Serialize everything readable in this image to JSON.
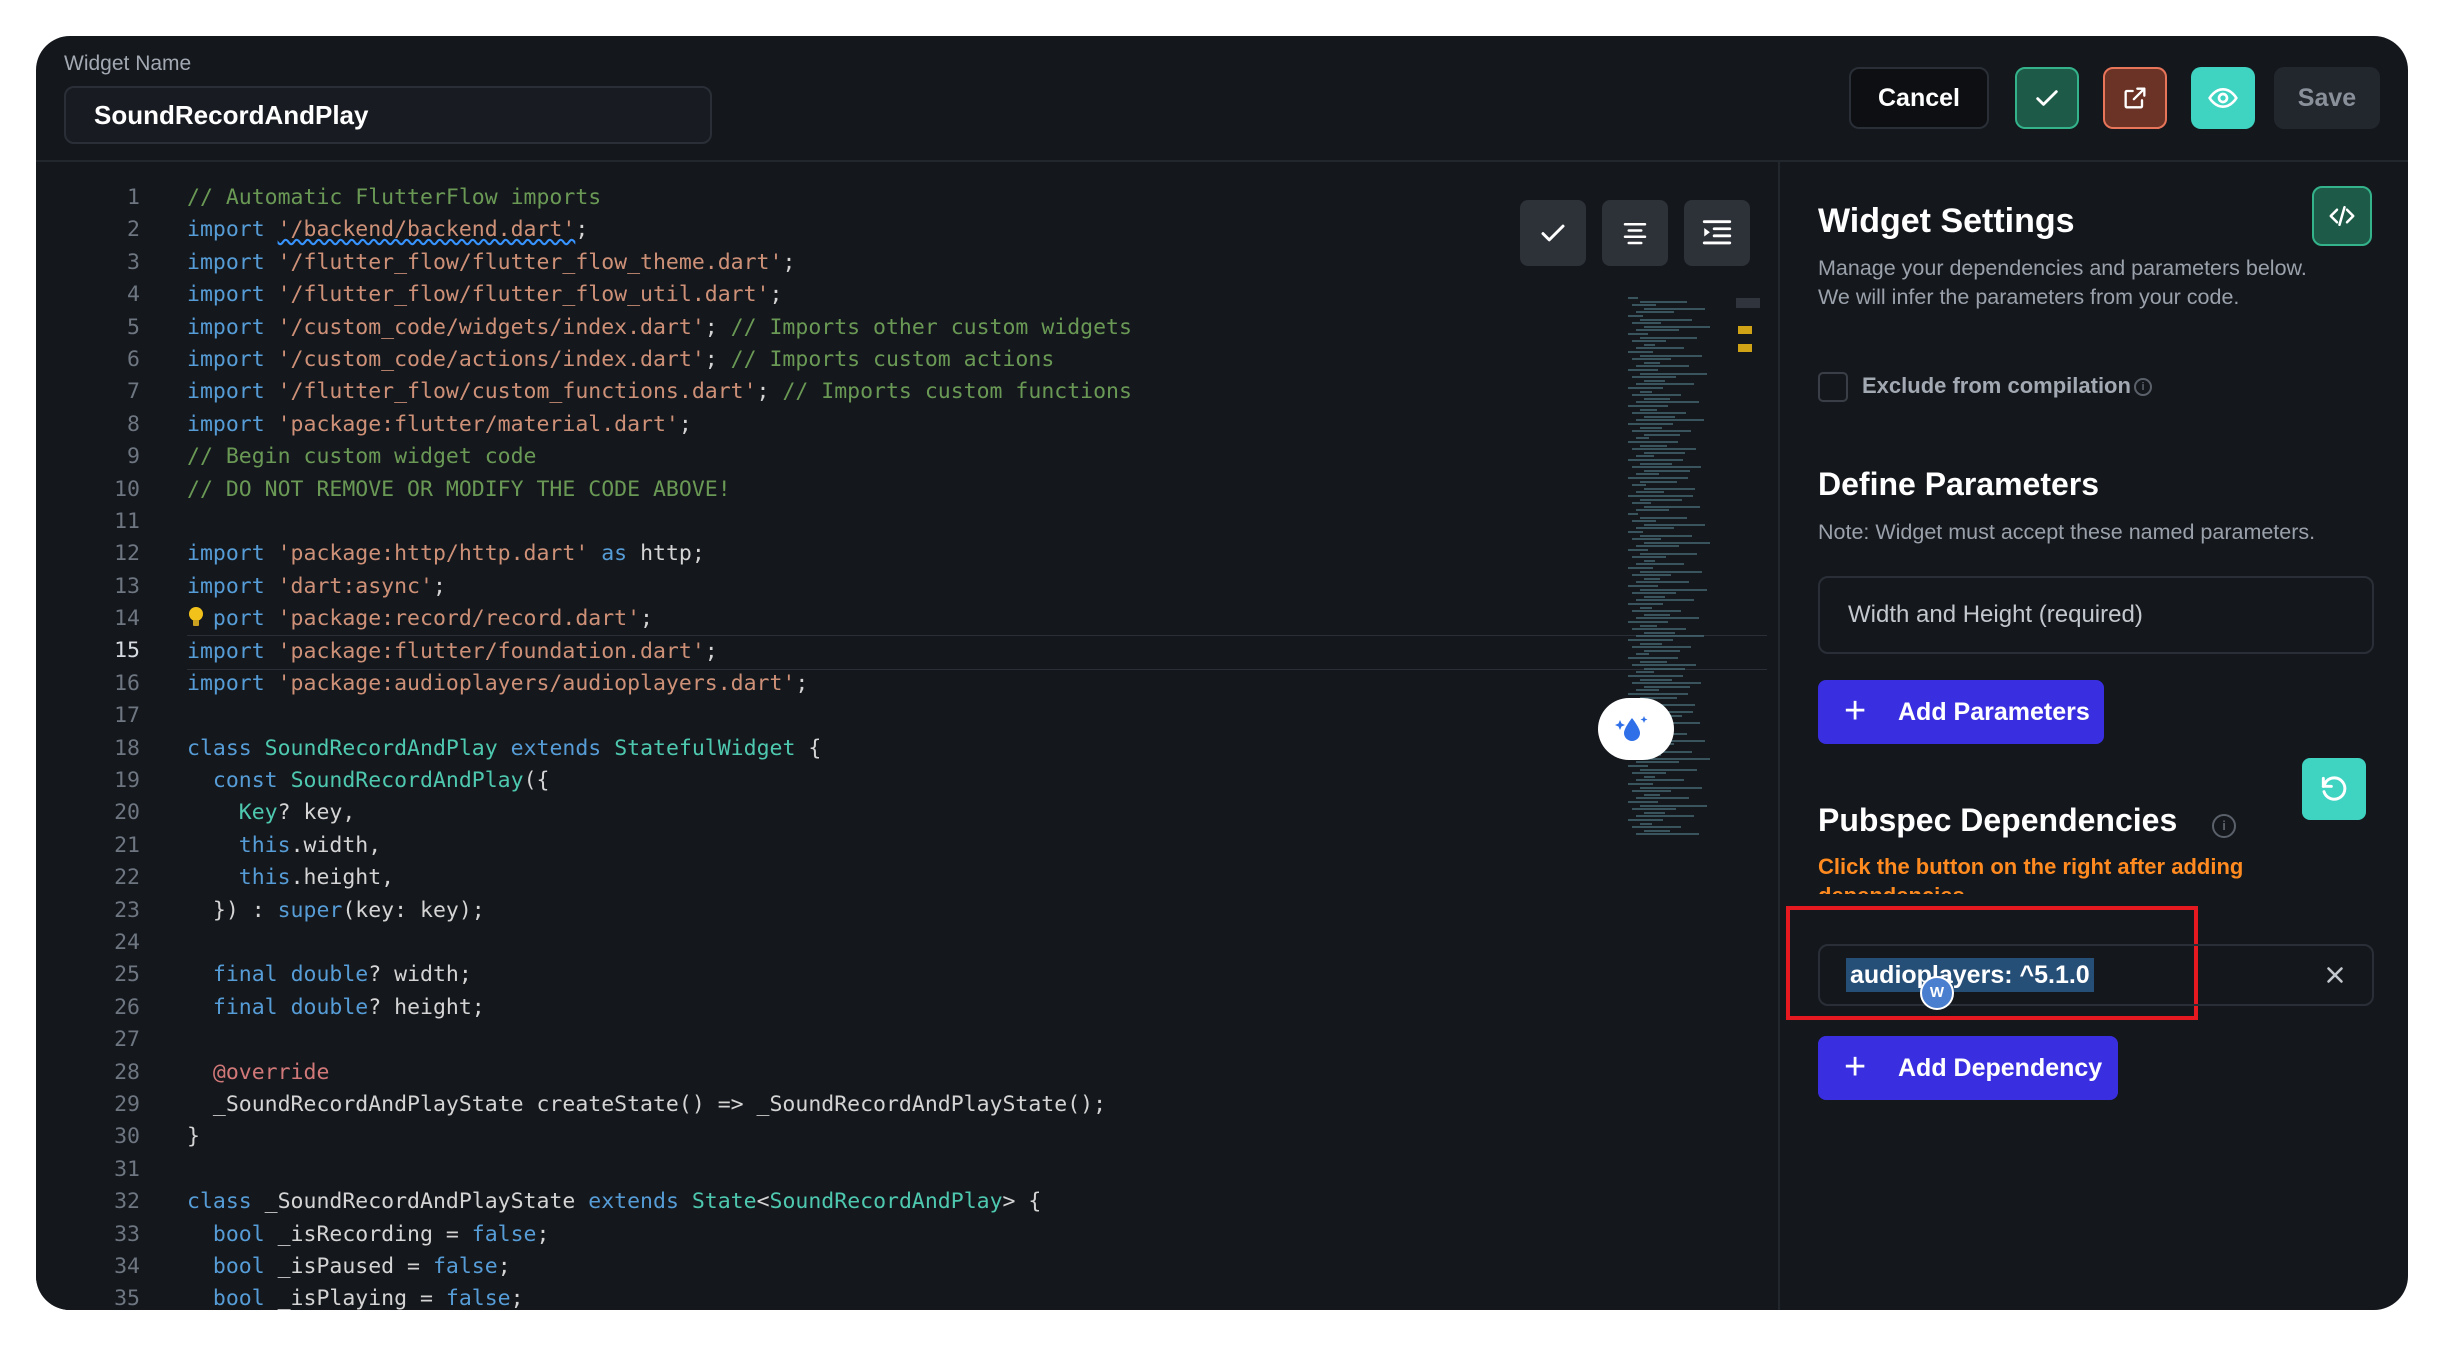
{
  "header": {
    "widget_name_label": "Widget Name",
    "widget_name_value": "SoundRecordAndPlay",
    "cancel_label": "Cancel",
    "save_label": "Save"
  },
  "editor": {
    "active_line": 15,
    "lines": [
      {
        "n": "1",
        "tokens": [
          [
            "// Automatic FlutterFlow imports",
            "cm"
          ]
        ]
      },
      {
        "n": "2",
        "tokens": [
          [
            "import ",
            "kw"
          ],
          [
            "'/backend/backend.dart'",
            "str-ul"
          ],
          [
            ";",
            "id"
          ]
        ]
      },
      {
        "n": "3",
        "tokens": [
          [
            "import ",
            "kw"
          ],
          [
            "'/flutter_flow/flutter_flow_theme.dart'",
            "str"
          ],
          [
            ";",
            "id"
          ]
        ]
      },
      {
        "n": "4",
        "tokens": [
          [
            "import ",
            "kw"
          ],
          [
            "'/flutter_flow/flutter_flow_util.dart'",
            "str"
          ],
          [
            ";",
            "id"
          ]
        ]
      },
      {
        "n": "5",
        "tokens": [
          [
            "import ",
            "kw"
          ],
          [
            "'/custom_code/widgets/index.dart'",
            "str"
          ],
          [
            "; ",
            "id"
          ],
          [
            "// Imports other custom widgets",
            "cm"
          ]
        ]
      },
      {
        "n": "6",
        "tokens": [
          [
            "import ",
            "kw"
          ],
          [
            "'/custom_code/actions/index.dart'",
            "str"
          ],
          [
            "; ",
            "id"
          ],
          [
            "// Imports custom actions",
            "cm"
          ]
        ]
      },
      {
        "n": "7",
        "tokens": [
          [
            "import ",
            "kw"
          ],
          [
            "'/flutter_flow/custom_functions.dart'",
            "str"
          ],
          [
            "; ",
            "id"
          ],
          [
            "// Imports custom functions",
            "cm"
          ]
        ]
      },
      {
        "n": "8",
        "tokens": [
          [
            "import ",
            "kw"
          ],
          [
            "'package:flutter/material.dart'",
            "str"
          ],
          [
            ";",
            "id"
          ]
        ]
      },
      {
        "n": "9",
        "tokens": [
          [
            "// Begin custom widget code",
            "cm"
          ]
        ]
      },
      {
        "n": "10",
        "tokens": [
          [
            "// DO NOT REMOVE OR MODIFY THE CODE ABOVE!",
            "cm"
          ]
        ]
      },
      {
        "n": "11",
        "tokens": []
      },
      {
        "n": "12",
        "tokens": [
          [
            "import ",
            "kw"
          ],
          [
            "'package:http/http.dart'",
            "str"
          ],
          [
            " as ",
            "kw"
          ],
          [
            "http;",
            "id"
          ]
        ]
      },
      {
        "n": "13",
        "tokens": [
          [
            "import ",
            "kw"
          ],
          [
            "'dart:async'",
            "str"
          ],
          [
            ";",
            "id"
          ]
        ]
      },
      {
        "n": "14",
        "tokens": [
          [
            "  port ",
            "kw"
          ],
          [
            "'package:record/record.dart'",
            "str"
          ],
          [
            ";",
            "id"
          ]
        ]
      },
      {
        "n": "15",
        "tokens": [
          [
            "import ",
            "kw"
          ],
          [
            "'package:flutter/foundation.dart'",
            "str"
          ],
          [
            ";",
            "id"
          ]
        ]
      },
      {
        "n": "16",
        "tokens": [
          [
            "import ",
            "kw"
          ],
          [
            "'package:audioplayers/audioplayers.dart'",
            "str"
          ],
          [
            ";",
            "id"
          ]
        ]
      },
      {
        "n": "17",
        "tokens": []
      },
      {
        "n": "18",
        "tokens": [
          [
            "class ",
            "kw"
          ],
          [
            "SoundRecordAndPlay ",
            "cls"
          ],
          [
            "extends ",
            "kw"
          ],
          [
            "StatefulWidget ",
            "cls"
          ],
          [
            "{",
            "id"
          ]
        ]
      },
      {
        "n": "19",
        "tokens": [
          [
            "  const ",
            "kw"
          ],
          [
            "SoundRecordAndPlay",
            "cls"
          ],
          [
            "({",
            "id"
          ]
        ]
      },
      {
        "n": "20",
        "tokens": [
          [
            "    Key",
            "cls"
          ],
          [
            "? key,",
            "id"
          ]
        ]
      },
      {
        "n": "21",
        "tokens": [
          [
            "    this",
            "kw"
          ],
          [
            ".width,",
            "id"
          ]
        ]
      },
      {
        "n": "22",
        "tokens": [
          [
            "    this",
            "kw"
          ],
          [
            ".height,",
            "id"
          ]
        ]
      },
      {
        "n": "23",
        "tokens": [
          [
            "  }) : ",
            "id"
          ],
          [
            "super",
            "kw"
          ],
          [
            "(key: key);",
            "id"
          ]
        ]
      },
      {
        "n": "24",
        "tokens": []
      },
      {
        "n": "25",
        "tokens": [
          [
            "  final ",
            "kw"
          ],
          [
            "double",
            "kw"
          ],
          [
            "? width;",
            "id"
          ]
        ]
      },
      {
        "n": "26",
        "tokens": [
          [
            "  final ",
            "kw"
          ],
          [
            "double",
            "kw"
          ],
          [
            "? height;",
            "id"
          ]
        ]
      },
      {
        "n": "27",
        "tokens": []
      },
      {
        "n": "28",
        "tokens": [
          [
            "  @override",
            "ann"
          ]
        ]
      },
      {
        "n": "29",
        "tokens": [
          [
            "  _SoundRecordAndPlayState createState() => _SoundRecordAndPlayState();",
            "id"
          ]
        ]
      },
      {
        "n": "30",
        "tokens": [
          [
            "}",
            "id"
          ]
        ]
      },
      {
        "n": "31",
        "tokens": []
      },
      {
        "n": "32",
        "tokens": [
          [
            "class ",
            "kw"
          ],
          [
            "_SoundRecordAndPlayState ",
            "id"
          ],
          [
            "extends ",
            "kw"
          ],
          [
            "State",
            "cls"
          ],
          [
            "<",
            "id"
          ],
          [
            "SoundRecordAndPlay",
            "cls"
          ],
          [
            "> {",
            "id"
          ]
        ]
      },
      {
        "n": "33",
        "tokens": [
          [
            "  bool ",
            "kw"
          ],
          [
            "_isRecording = ",
            "id"
          ],
          [
            "false",
            "kw"
          ],
          [
            ";",
            "id"
          ]
        ]
      },
      {
        "n": "34",
        "tokens": [
          [
            "  bool ",
            "kw"
          ],
          [
            "_isPaused = ",
            "id"
          ],
          [
            "false",
            "kw"
          ],
          [
            ";",
            "id"
          ]
        ]
      },
      {
        "n": "35",
        "tokens": [
          [
            "  bool ",
            "kw"
          ],
          [
            "_isPlaying = ",
            "id"
          ],
          [
            "false",
            "kw"
          ],
          [
            ";",
            "id"
          ]
        ]
      }
    ]
  },
  "settings": {
    "title": "Widget Settings",
    "description": "Manage your dependencies and parameters below.\nWe will infer the parameters from your code.",
    "exclude_label": "Exclude from compilation",
    "define_title": "Define Parameters",
    "define_note": "Note: Widget must accept these named parameters.",
    "param_field": "Width and Height (required)",
    "add_parameters_label": "Add Parameters",
    "pubspec_title": "Pubspec Dependencies",
    "pubspec_warning": "Click the button on the right after adding dependencies",
    "dependency_value": "audioplayers: ^5.1.0",
    "add_dependency_label": "Add Dependency",
    "avatar_letter": "W"
  },
  "colors": {
    "background": "#14171c",
    "accent_purple": "#3a2fe0",
    "accent_teal": "#3fd3c2",
    "warning_orange": "#ff8a1f",
    "highlight_red": "#e5191f"
  },
  "icons": [
    "check-icon",
    "external-link-icon",
    "eye-icon",
    "align-center-icon",
    "indent-icon",
    "code-icon",
    "info-icon",
    "plus-icon",
    "refresh-icon",
    "close-icon",
    "lightbulb-icon",
    "ai-sparkle-icon"
  ]
}
